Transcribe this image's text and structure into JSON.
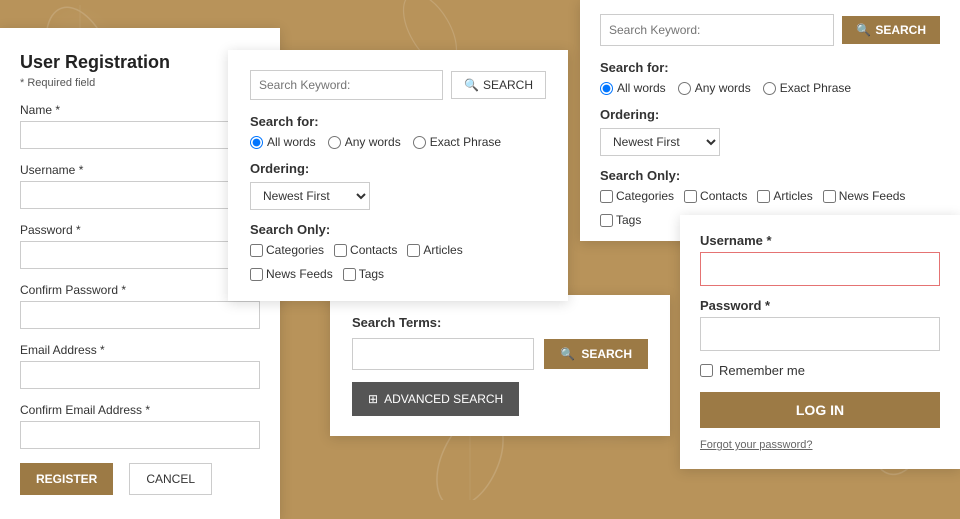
{
  "background": {
    "color": "#b8935a"
  },
  "registration": {
    "title": "User Registration",
    "required_note": "* Required field",
    "fields": [
      {
        "id": "name",
        "label": "Name *",
        "type": "text"
      },
      {
        "id": "username",
        "label": "Username *",
        "type": "text"
      },
      {
        "id": "password",
        "label": "Password *",
        "type": "password"
      },
      {
        "id": "confirm_password",
        "label": "Confirm Password *",
        "type": "password"
      },
      {
        "id": "email",
        "label": "Email Address *",
        "type": "email"
      },
      {
        "id": "confirm_email",
        "label": "Confirm Email Address *",
        "type": "email"
      }
    ],
    "register_label": "REGISTER",
    "cancel_label": "CANCEL"
  },
  "search_small": {
    "keyword_placeholder": "Search Keyword:",
    "search_label": "SEARCH",
    "search_for_title": "Search for:",
    "radio_options": [
      {
        "id": "all_words",
        "label": "All words",
        "checked": true
      },
      {
        "id": "any_words",
        "label": "Any words",
        "checked": false
      },
      {
        "id": "exact_phrase",
        "label": "Exact Phrase",
        "checked": false
      }
    ],
    "ordering_title": "Ordering:",
    "ordering_options": [
      {
        "value": "newest",
        "label": "Newest First",
        "selected": true
      }
    ],
    "search_only_title": "Search Only:",
    "checkboxes": [
      {
        "id": "categories",
        "label": "Categories"
      },
      {
        "id": "contacts",
        "label": "Contacts"
      },
      {
        "id": "articles",
        "label": "Articles"
      },
      {
        "id": "news_feeds",
        "label": "News Feeds"
      },
      {
        "id": "tags",
        "label": "Tags"
      }
    ]
  },
  "search_top": {
    "keyword_placeholder": "Search Keyword:",
    "search_label": "SEARCH",
    "search_for_title": "Search for:",
    "radio_options": [
      {
        "id": "top_all_words",
        "label": "All words",
        "checked": true
      },
      {
        "id": "top_any_words",
        "label": "Any words",
        "checked": false
      },
      {
        "id": "top_exact_phrase",
        "label": "Exact Phrase",
        "checked": false
      }
    ],
    "ordering_title": "Ordering:",
    "ordering_options": [
      {
        "value": "newest",
        "label": "Newest First",
        "selected": true
      }
    ],
    "search_only_title": "Search Only:",
    "checkboxes": [
      {
        "id": "top_categories",
        "label": "Categories"
      },
      {
        "id": "top_contacts",
        "label": "Contacts"
      },
      {
        "id": "top_articles",
        "label": "Articles"
      },
      {
        "id": "top_news_feeds",
        "label": "News Feeds"
      },
      {
        "id": "top_tags",
        "label": "Tags"
      }
    ]
  },
  "search_terms": {
    "title": "Search Terms:",
    "search_label": "SEARCH",
    "advanced_label": "ADVANCED SEARCH"
  },
  "login": {
    "username_label": "Username *",
    "password_label": "Password *",
    "remember_label": "Remember me",
    "login_label": "LOG IN",
    "forgot_label": "Forgot your password?"
  }
}
